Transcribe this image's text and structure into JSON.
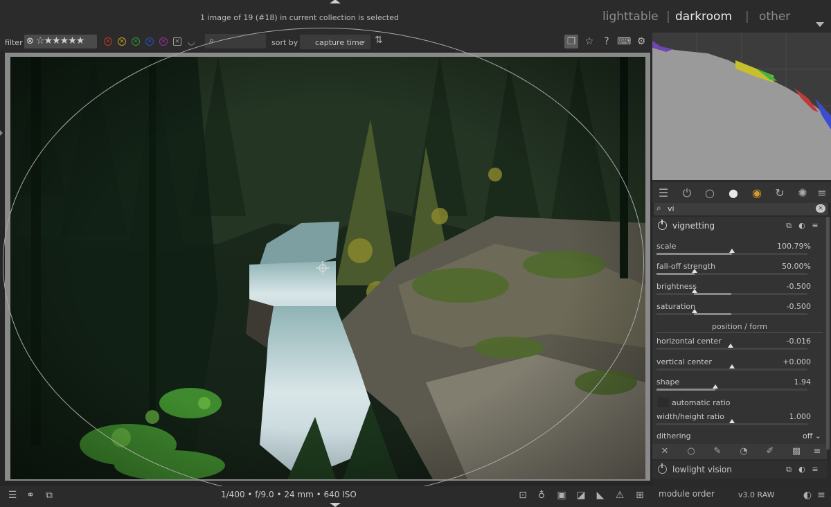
{
  "header": {
    "selection_info": "1 image of 19 (#18) in current collection is selected",
    "views": {
      "lighttable": "lighttable",
      "darkroom": "darkroom",
      "other": "other",
      "separator": "|"
    }
  },
  "filterbar": {
    "filter_label": "filter",
    "reject_glyph": "⊗",
    "stars_glyph": "☆★★★★★",
    "color_labels": [
      "red",
      "yellow",
      "green",
      "blue",
      "purple",
      "all",
      "any"
    ],
    "sort_by_label": "sort by",
    "sort_value": "capture time"
  },
  "colors": {
    "accent": "#ebebeb",
    "panel": "#333333",
    "label_red": "#c0392b",
    "label_yellow": "#c9a227",
    "label_green": "#2e9b3c",
    "label_blue": "#2f4fbd",
    "label_purple": "#9b2fa6"
  },
  "module_search": {
    "value": "vi"
  },
  "vignetting": {
    "title": "vignetting",
    "scale": {
      "label": "scale",
      "value": "100.79%",
      "fraction": 0.5
    },
    "falloff": {
      "label": "fall-off strength",
      "value": "50.00%",
      "fraction": 0.25
    },
    "brightness": {
      "label": "brightness",
      "value": "-0.500",
      "fraction": 0.25
    },
    "saturation": {
      "label": "saturation",
      "value": "-0.500",
      "fraction": 0.25
    },
    "section": "position / form",
    "hcenter": {
      "label": "horizontal center",
      "value": "-0.016",
      "fraction": 0.49
    },
    "vcenter": {
      "label": "vertical center",
      "value": "+0.000",
      "fraction": 0.5
    },
    "shape": {
      "label": "shape",
      "value": "1.94",
      "fraction": 0.39
    },
    "auto_ratio": "automatic ratio",
    "ratio": {
      "label": "width/height ratio",
      "value": "1.000",
      "fraction": 0.5
    },
    "dithering": {
      "label": "dithering",
      "value": "off"
    }
  },
  "lowlight": {
    "title": "lowlight vision"
  },
  "bottombar": {
    "exif": "1/400 • f/9.0 • 24 mm • 640 ISO",
    "module_order_label": "module order",
    "module_order_value": "v3.0 RAW"
  }
}
